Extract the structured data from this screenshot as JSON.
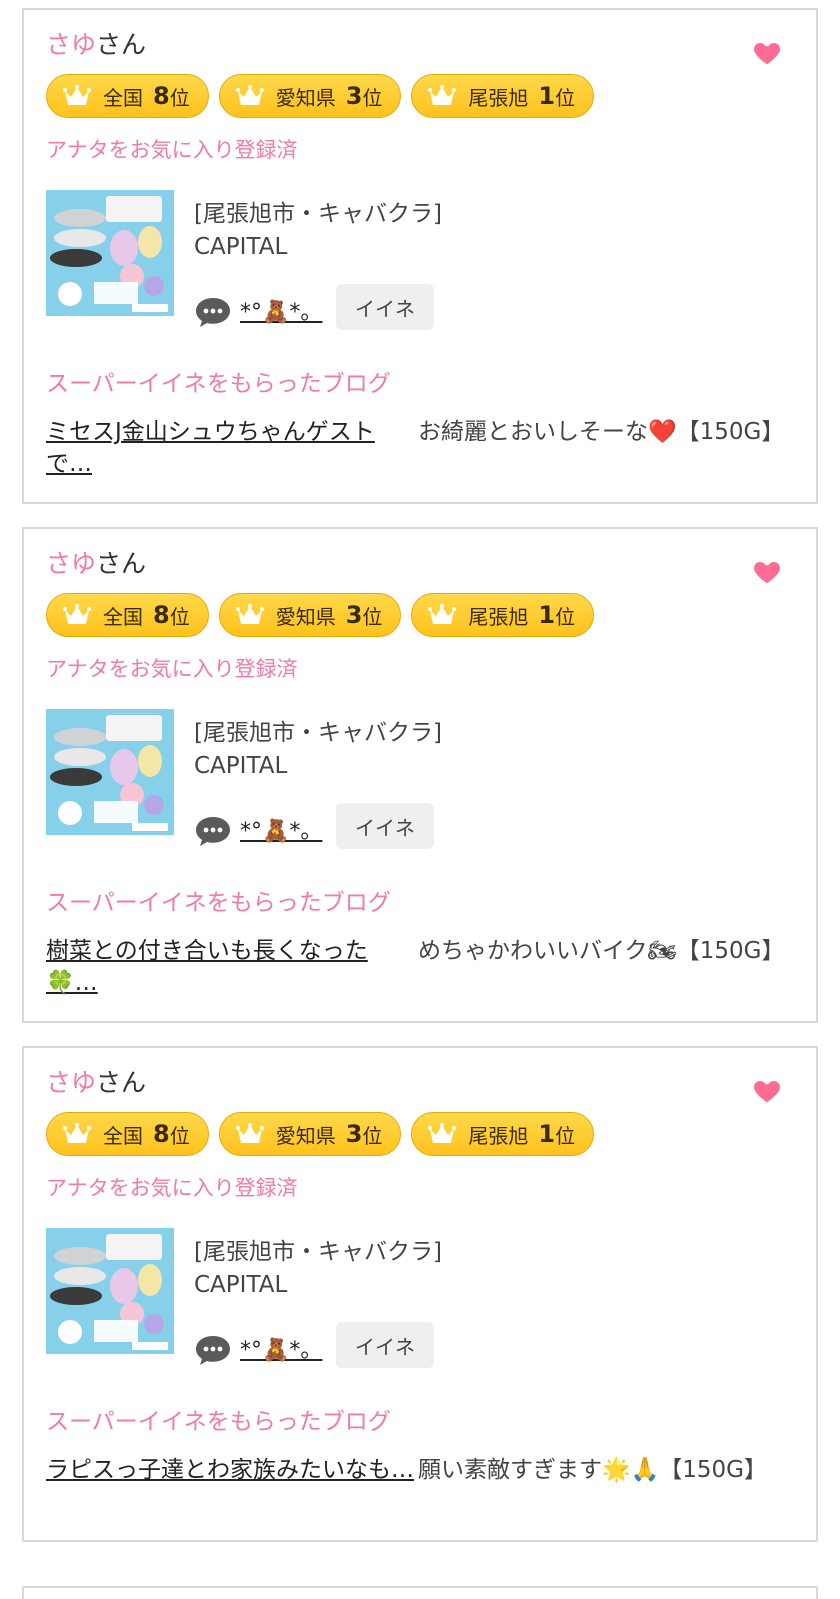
{
  "cards": [
    {
      "name": "さゆ",
      "name_suffix": "さん",
      "ranks": [
        {
          "label": "全国",
          "num": "8",
          "unit": "位"
        },
        {
          "label": "愛知県",
          "num": "3",
          "unit": "位"
        },
        {
          "label": "尾張旭",
          "num": "1",
          "unit": "位"
        }
      ],
      "fav_note": "アナタをお気に入り登録済",
      "store_area": "[尾張旭市・キャバクラ]",
      "store_name": "CAPITAL",
      "comment_user": "*°🧸*。",
      "like_label": "イイネ",
      "section_title": "スーパーイイネをもらったブログ",
      "blog_title": "ミセスJ金山シュウちゃんゲストで…",
      "blog_comment": "お綺麗とおいしそーな❤️【150G】"
    },
    {
      "name": "さゆ",
      "name_suffix": "さん",
      "ranks": [
        {
          "label": "全国",
          "num": "8",
          "unit": "位"
        },
        {
          "label": "愛知県",
          "num": "3",
          "unit": "位"
        },
        {
          "label": "尾張旭",
          "num": "1",
          "unit": "位"
        }
      ],
      "fav_note": "アナタをお気に入り登録済",
      "store_area": "[尾張旭市・キャバクラ]",
      "store_name": "CAPITAL",
      "comment_user": "*°🧸*。",
      "like_label": "イイネ",
      "section_title": "スーパーイイネをもらったブログ",
      "blog_title": "樹菜との付き合いも長くなった🍀…",
      "blog_comment": "めちゃかわいいバイク🏍【150G】"
    },
    {
      "name": "さゆ",
      "name_suffix": "さん",
      "ranks": [
        {
          "label": "全国",
          "num": "8",
          "unit": "位"
        },
        {
          "label": "愛知県",
          "num": "3",
          "unit": "位"
        },
        {
          "label": "尾張旭",
          "num": "1",
          "unit": "位"
        }
      ],
      "fav_note": "アナタをお気に入り登録済",
      "store_area": "[尾張旭市・キャバクラ]",
      "store_name": "CAPITAL",
      "comment_user": "*°🧸*。",
      "like_label": "イイネ",
      "section_title": "スーパーイイネをもらったブログ",
      "blog_title": "ラピスっ子達とわ家族みたいなも…",
      "blog_comment": "願い素敵すぎます🌟🙏【150G】"
    }
  ],
  "colors": {
    "accent_pink": "#f07aa8",
    "heart": "#ff6b93",
    "badge_yellow": "#ffc21c",
    "border": "#d9d9d9"
  },
  "icons": {
    "favorite": "heart-icon",
    "rank": "crown-icon",
    "comment": "speech-bubble-icon"
  }
}
